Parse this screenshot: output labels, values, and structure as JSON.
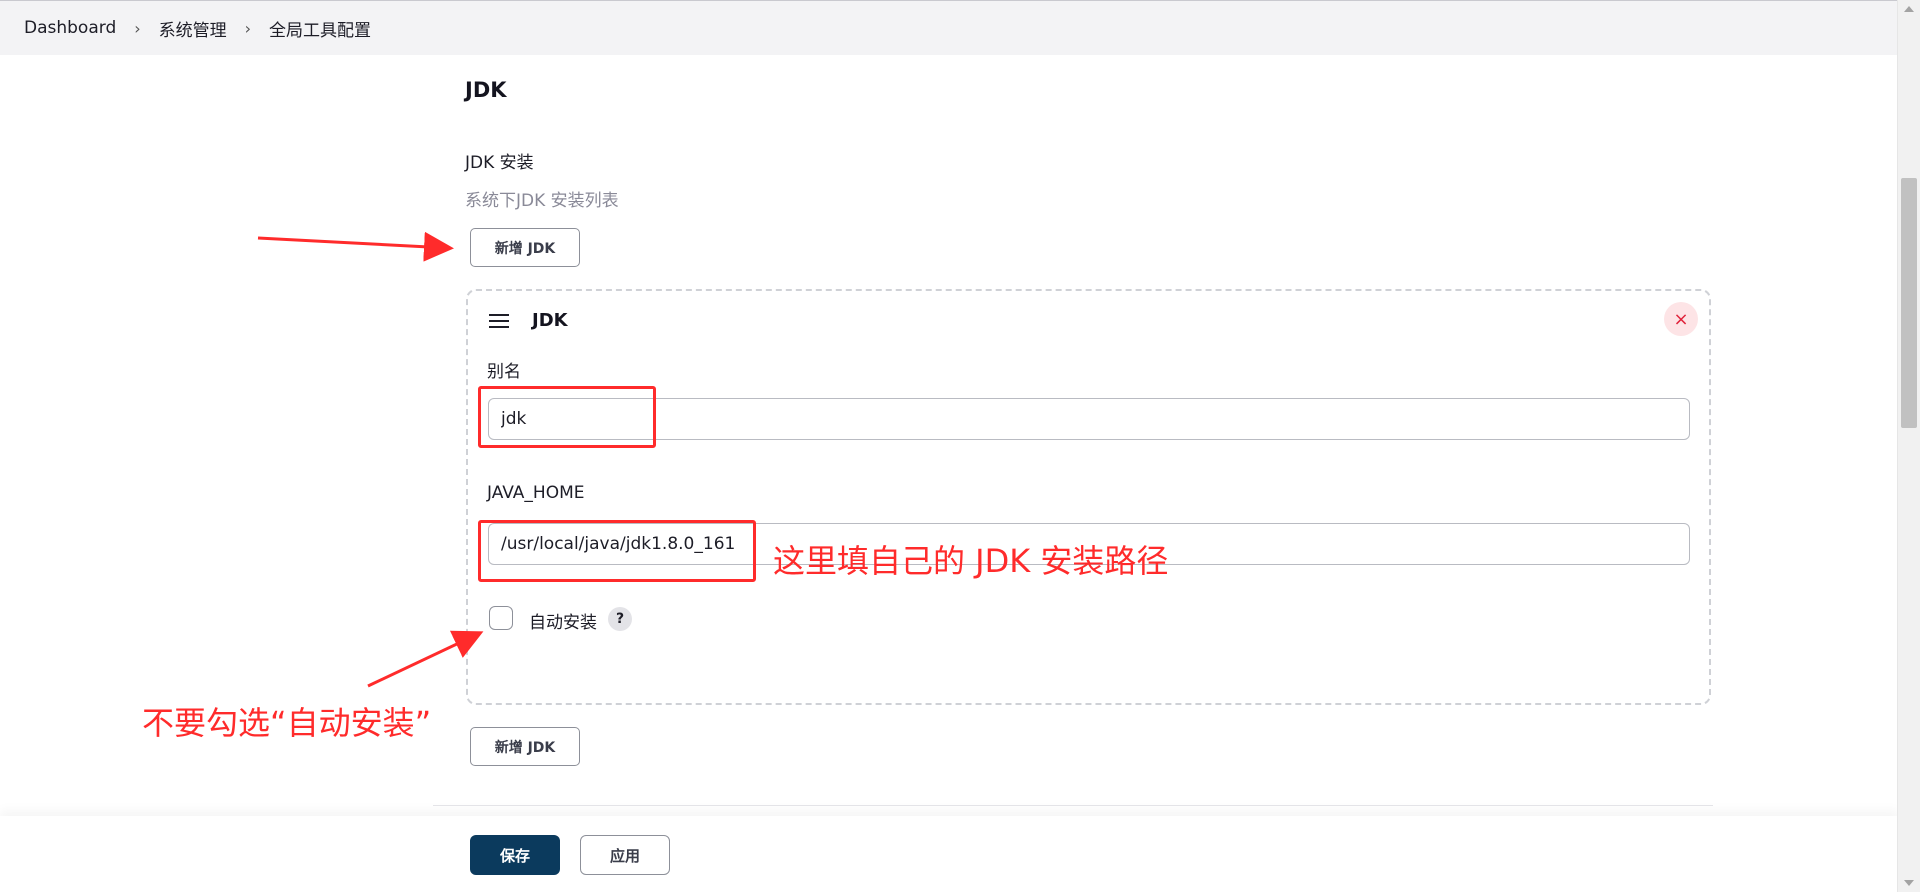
{
  "breadcrumb": {
    "items": [
      "Dashboard",
      "系统管理",
      "全局工具配置"
    ],
    "separator": "›"
  },
  "section": {
    "title": "JDK",
    "installs_label": "JDK 安装",
    "description": "系统下JDK 安装列表",
    "add_button": "新增 JDK"
  },
  "jdk_card": {
    "title": "JDK",
    "close_symbol": "×",
    "alias_label": "别名",
    "alias_value": "jdk",
    "java_home_label": "JAVA_HOME",
    "java_home_value": "/usr/local/java/jdk1.8.0_161",
    "auto_install_label": "自动安装",
    "help_symbol": "?"
  },
  "add_button_bottom": "新增 JDK",
  "footer": {
    "save_label": "保存",
    "apply_label": "应用"
  },
  "annotations": {
    "java_home_note": "这里填自己的 JDK 安装路径",
    "auto_install_note": "不要勾选“自动安装”"
  },
  "colors": {
    "annotation": "#ff2b2b",
    "primary": "#0b3a5d",
    "close_bg": "#fde4e6",
    "close_fg": "#e0223a"
  }
}
